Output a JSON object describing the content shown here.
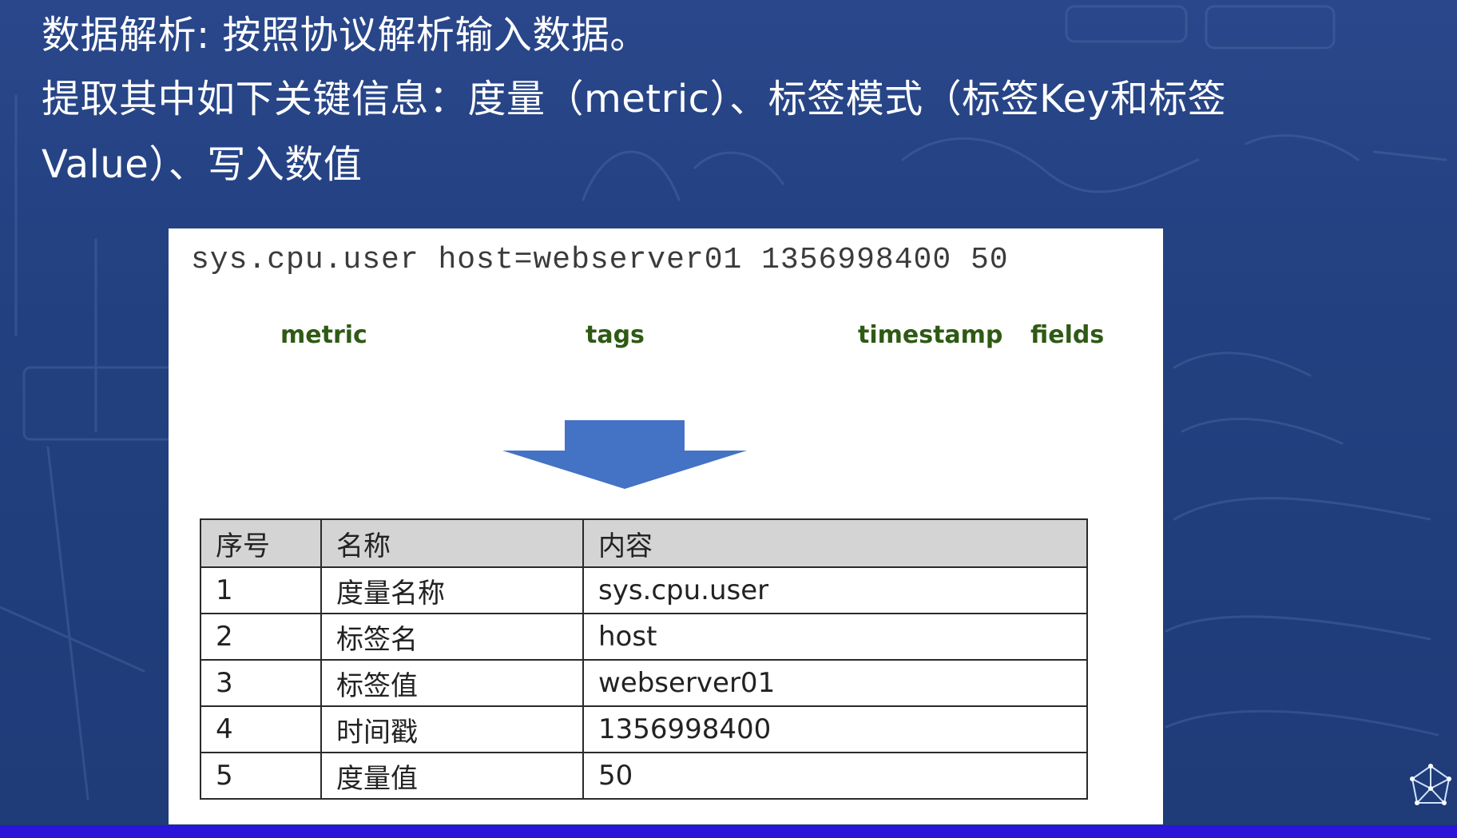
{
  "heading": {
    "line1": "数据解析: 按照协议解析输入数据。",
    "line2": "提取其中如下关键信息：度量（metric）、标签模式（标签Key和标签",
    "line3": "Value）、写入数值"
  },
  "example": {
    "code_line": "sys.cpu.user host=webserver01 1356998400 50",
    "labels": {
      "metric": "metric",
      "tags": "tags",
      "timestamp": "timestamp",
      "fields": "fields"
    }
  },
  "table": {
    "headers": [
      "序号",
      "名称",
      "内容"
    ],
    "rows": [
      [
        "1",
        "度量名称",
        "sys.cpu.user"
      ],
      [
        "2",
        "标签名",
        "host"
      ],
      [
        "3",
        "标签值",
        "webserver01"
      ],
      [
        "4",
        "时间戳",
        "1356998400"
      ],
      [
        "5",
        "度量值",
        "50"
      ]
    ]
  },
  "colors": {
    "background": "#233d7a",
    "arrow": "#4472c4",
    "label_text": "#2e5a14",
    "header_fill": "#d4d4d4",
    "bottom_bar": "#2a15d8"
  },
  "icons": {
    "arrow": "down-arrow-icon",
    "logo": "network-logo-icon"
  }
}
